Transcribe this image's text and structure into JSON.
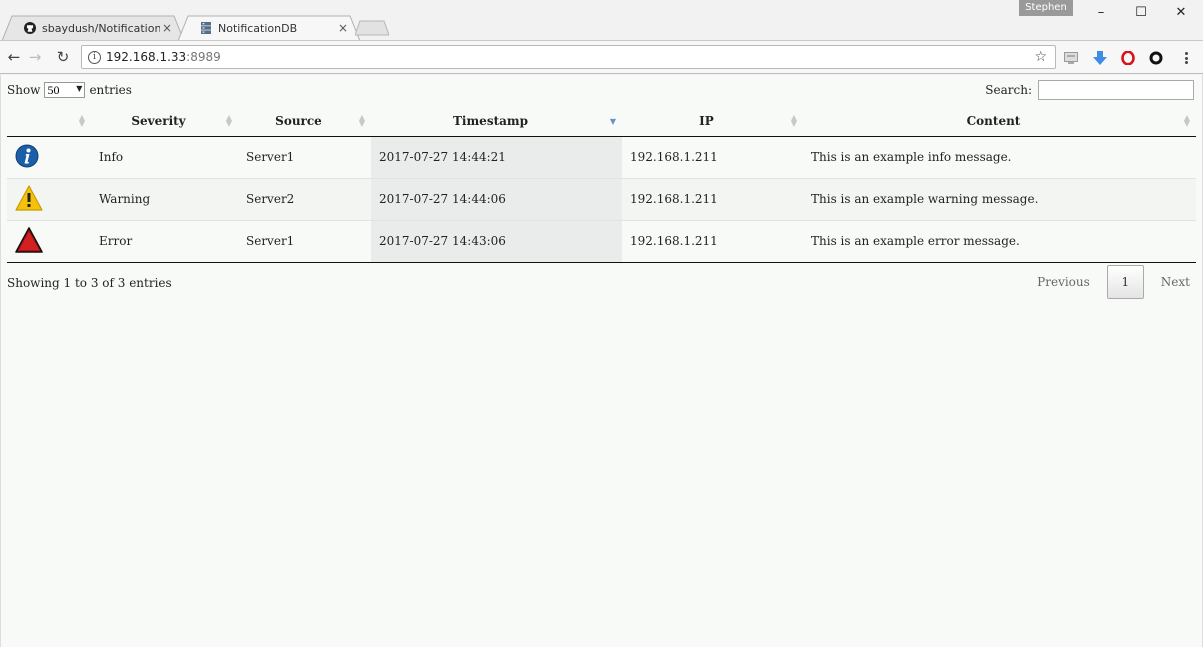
{
  "browser": {
    "tabs": [
      {
        "title": "sbaydush/NotificationDB",
        "icon": "github-icon",
        "active": false
      },
      {
        "title": "NotificationDB",
        "icon": "database-icon",
        "active": true
      }
    ],
    "profile_name": "Stephen",
    "url_host": "192.168.1.33",
    "url_port": ":8989",
    "window_controls": {
      "minimize": "–",
      "maximize": "☐",
      "close": "✕"
    }
  },
  "page": {
    "show_label": "Show",
    "entries_label": "entries",
    "length_value": "50",
    "search_label": "Search:",
    "columns": [
      "",
      "Severity",
      "Source",
      "Timestamp",
      "IP",
      "Content"
    ],
    "rows": [
      {
        "icon": "info-icon",
        "severity": "Info",
        "source": "Server1",
        "timestamp": "2017-07-27 14:44:21",
        "ip": "192.168.1.211",
        "content": "This is an example info message."
      },
      {
        "icon": "warning-icon",
        "severity": "Warning",
        "source": "Server2",
        "timestamp": "2017-07-27 14:44:06",
        "ip": "192.168.1.211",
        "content": "This is an example warning message."
      },
      {
        "icon": "error-icon",
        "severity": "Error",
        "source": "Server1",
        "timestamp": "2017-07-27 14:43:06",
        "ip": "192.168.1.211",
        "content": "This is an example error message."
      }
    ],
    "footer_info": "Showing 1 to 3 of 3 entries",
    "pagination": {
      "previous": "Previous",
      "current": "1",
      "next": "Next"
    },
    "colors": {
      "info": "#1a5fa8",
      "warning": "#f4c20d",
      "error": "#b11212",
      "sort_active": "#6c8fc7"
    }
  }
}
